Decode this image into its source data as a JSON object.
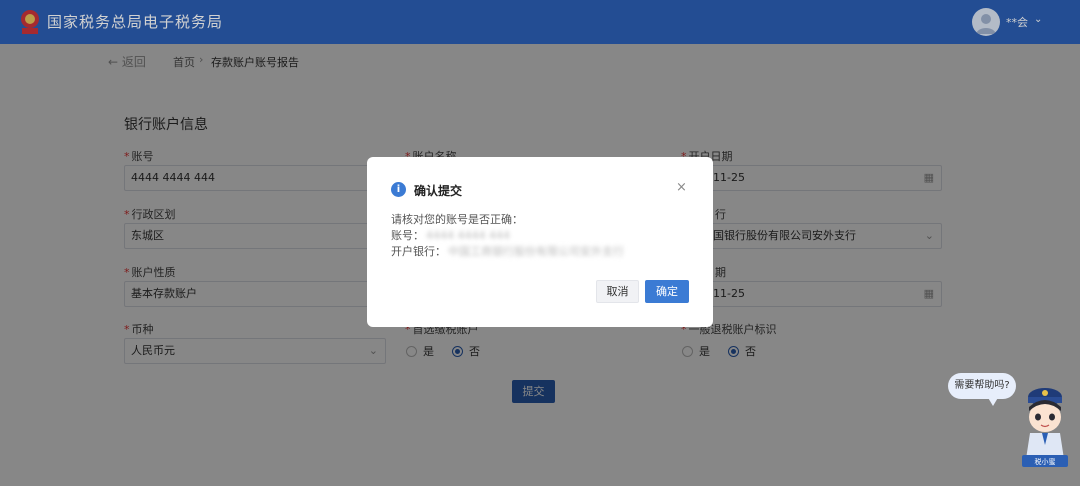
{
  "header": {
    "site_title": "国家税务总局电子税务局",
    "user_name": "**会",
    "chevron": "⌄"
  },
  "breadcrumb": {
    "back": "← 返回",
    "home": "首页",
    "separator": "›",
    "current": "存款账户账号报告"
  },
  "form": {
    "section_title": "银行账户信息",
    "fields": {
      "account_no": {
        "label": "账号",
        "value": "4444 4444 444"
      },
      "account_name": {
        "label": "账户名称"
      },
      "open_date": {
        "label": "开户日期",
        "value": "11-25",
        "icon": "calendar-icon"
      },
      "district": {
        "label": "行政区划",
        "value": "东城区"
      },
      "bank": {
        "label": "行",
        "value": "国银行股份有限公司安外支行"
      },
      "account_nature": {
        "label": "账户性质",
        "value": "基本存款账户"
      },
      "second_date": {
        "label": "期",
        "value": "11-25",
        "icon": "calendar-icon"
      },
      "currency": {
        "label": "币种",
        "value": "人民币元"
      },
      "first_radio": {
        "label": "首选缴税账户",
        "yes": "是",
        "no": "否",
        "selected": "no"
      },
      "refund_radio": {
        "label": "一般退税账户标识",
        "yes": "是",
        "no": "否",
        "selected": "no"
      }
    },
    "submit_label": "提交"
  },
  "dialog": {
    "icon": "info-icon",
    "title": "确认提交",
    "close": "×",
    "prompt": "请核对您的账号是否正确：",
    "account_label": "账号：",
    "account_value": "4444 4444 444",
    "bank_label": "开户银行：",
    "bank_value": "中国工商银行股份有限公司安外支行",
    "cancel_label": "取消",
    "ok_label": "确定"
  },
  "helper": {
    "bubble": "需要帮助吗?",
    "badge": "税小蜜"
  },
  "colors": {
    "primary": "#2b5fb4",
    "dialog_button": "#3b7bd4",
    "required": "#ee3333"
  }
}
